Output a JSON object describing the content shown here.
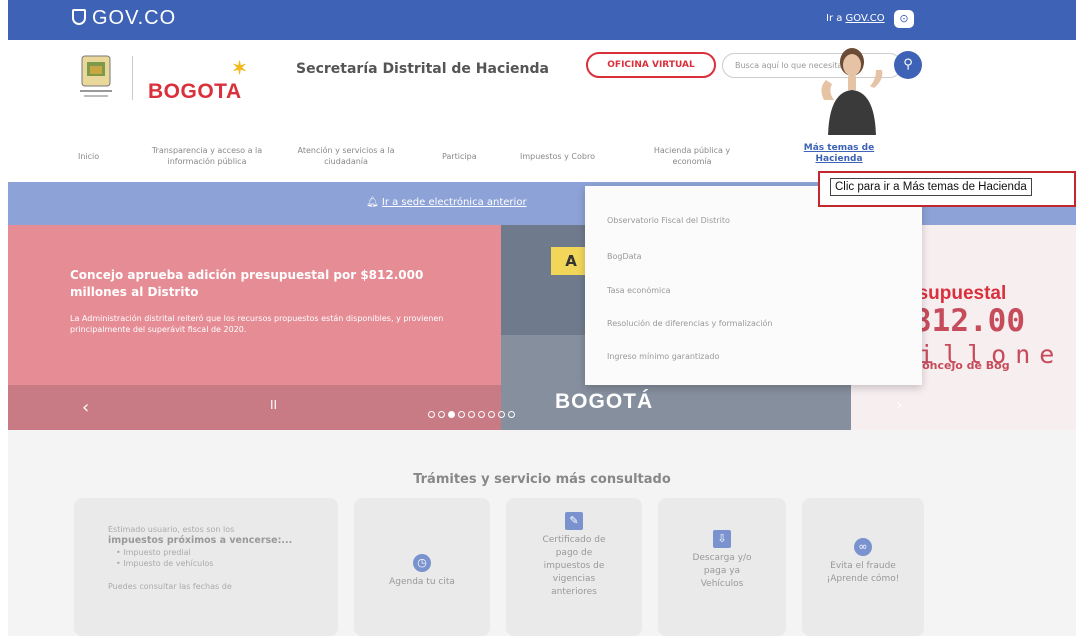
{
  "gov_bar": {
    "logo": "GOV.CO",
    "link_prefix": "Ir a ",
    "link": "GOV.CO"
  },
  "header": {
    "brand": "BOGOTA",
    "secretaria": "Secretaría Distrital de Hacienda",
    "oficina_virtual": "OFICINA VIRTUAL",
    "search_placeholder": "Busca aquí lo que necesitas"
  },
  "nav": {
    "items": [
      {
        "label": "Inicio"
      },
      {
        "label": "Transparencia y acceso a la información pública"
      },
      {
        "label": "Atención y servicios a la ciudadanía"
      },
      {
        "label": "Participa"
      },
      {
        "label": "Impuestos y Cobro"
      },
      {
        "label": "Hacienda pública y economía"
      },
      {
        "label": "Más temas de Hacienda"
      }
    ]
  },
  "notice": {
    "text": "Ir a sede electrónica anterior"
  },
  "banner": {
    "title": "Concejo aprueba adición presupuestal por $812.000 millones al Distrito",
    "body": "La Administración distrital reiteró que los recursos propuestos están disponibles, y provienen principalmente del superávit fiscal de 2020.",
    "a_mark": "A",
    "wordmark": "BOGOTÁ",
    "pres_l1": "esupuestal",
    "pres_l2": "812.00",
    "pres_l3": "illone",
    "pres_l4": "Concejo de Bog",
    "prev": "‹",
    "next": "›",
    "pause": "II"
  },
  "dropdown": {
    "items": [
      "Observatorio Fiscal del Distrito",
      "BogData",
      "Tasa económica",
      "Resolución de diferencias y formalización",
      "Ingreso mínimo garantizado"
    ]
  },
  "tooltip": {
    "text": "Clic para ir a Más temas de Hacienda"
  },
  "services": {
    "title": "Trámites y servicio más consultado",
    "first_card": {
      "intro": "Estimado usuario, estos son los",
      "bold": "impuestos próximos a vencerse:...",
      "items": [
        "Impuesto predial",
        "Impuesto de vehículos"
      ],
      "footer": "Puedes consultar las fechas de"
    },
    "cards": [
      {
        "label": "Agenda tu cita",
        "icon": "clock-icon"
      },
      {
        "label": "Certificado de pago de impuestos de vigencias anteriores",
        "icon": "certificate-icon"
      },
      {
        "label": "Descarga y/o paga ya Vehículos",
        "icon": "document-download-icon"
      },
      {
        "label": "Evita el fraude ¡Aprende cómo!",
        "icon": "mask-icon"
      }
    ]
  }
}
